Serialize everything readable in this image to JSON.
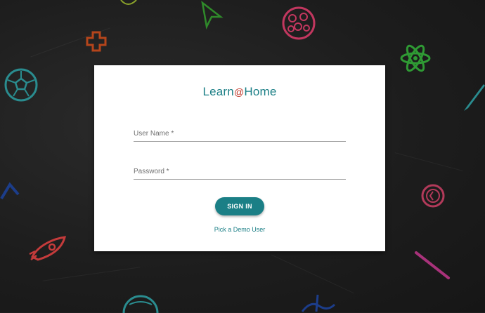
{
  "logo": {
    "prefix": "Learn",
    "at": "@",
    "suffix": "Home"
  },
  "form": {
    "username_label": "User Name *",
    "password_label": "Password *",
    "signin_label": "SIGN IN",
    "demo_link": "Pick a Demo User"
  },
  "decor_icons": [
    "cursor-icon",
    "cross-icon",
    "cookie-icon",
    "soccer-ball-icon",
    "atom-icon",
    "pencil-icon",
    "magnet-icon",
    "rocket-icon",
    "clock-icon",
    "line-icon",
    "globe-icon",
    "wave-icon"
  ],
  "colors": {
    "teal": "#1b7f86",
    "red": "#c0392b",
    "background": "#1f1f1f"
  }
}
